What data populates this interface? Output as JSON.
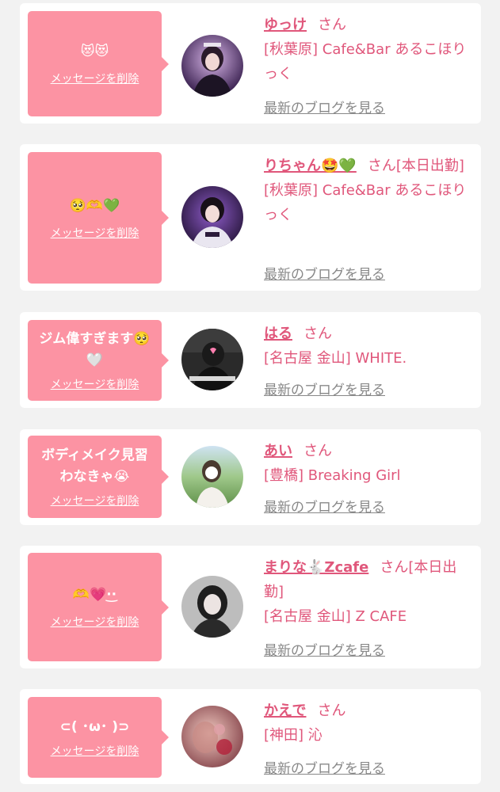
{
  "messages": [
    {
      "message": "😻😻",
      "delete_label": "メッセージを削除",
      "name": "ゆっけ",
      "honorific": "さん",
      "status": "",
      "shop": "[秋葉原] Cafe&Bar あるこほりっく",
      "blog_label": "最新のブログを見る"
    },
    {
      "message": "🥺🫶💚",
      "delete_label": "メッセージを削除",
      "name": "りちゃん🤩💚",
      "honorific": "さん",
      "status": "[本日出勤]",
      "shop": "[秋葉原] Cafe&Bar あるこほりっく",
      "blog_label": "最新のブログを見る"
    },
    {
      "message": "ジム偉すぎます🥺\n🤍",
      "delete_label": "メッセージを削除",
      "name": "はる",
      "honorific": "さん",
      "status": "",
      "shop": "[名古屋 金山] WHITE.",
      "blog_label": "最新のブログを見る"
    },
    {
      "message": "ボディメイク見習\nわなきゃ😭",
      "delete_label": "メッセージを削除",
      "name": "あい",
      "honorific": "さん",
      "status": "",
      "shop": "[豊橋] Breaking Girl",
      "blog_label": "最新のブログを見る"
    },
    {
      "message": "🫶💗·͜·",
      "delete_label": "メッセージを削除",
      "name": "まりな🐇Zcafe",
      "honorific": "さん",
      "status": "[本日出勤]",
      "shop": "[名古屋 金山] Z CAFE",
      "blog_label": "最新のブログを見る"
    },
    {
      "message": "⊂( ･ω･ )⊃",
      "delete_label": "メッセージを削除",
      "name": "かえで",
      "honorific": "さん",
      "status": "",
      "shop": "[神田] 沁",
      "blog_label": "最新のブログを見る"
    }
  ],
  "colors": {
    "page_background": "#f2f2f2",
    "card_background": "#ffffff",
    "bubble": "#fc93a3",
    "accent_text": "#e0577b",
    "link_grey": "#888888"
  }
}
